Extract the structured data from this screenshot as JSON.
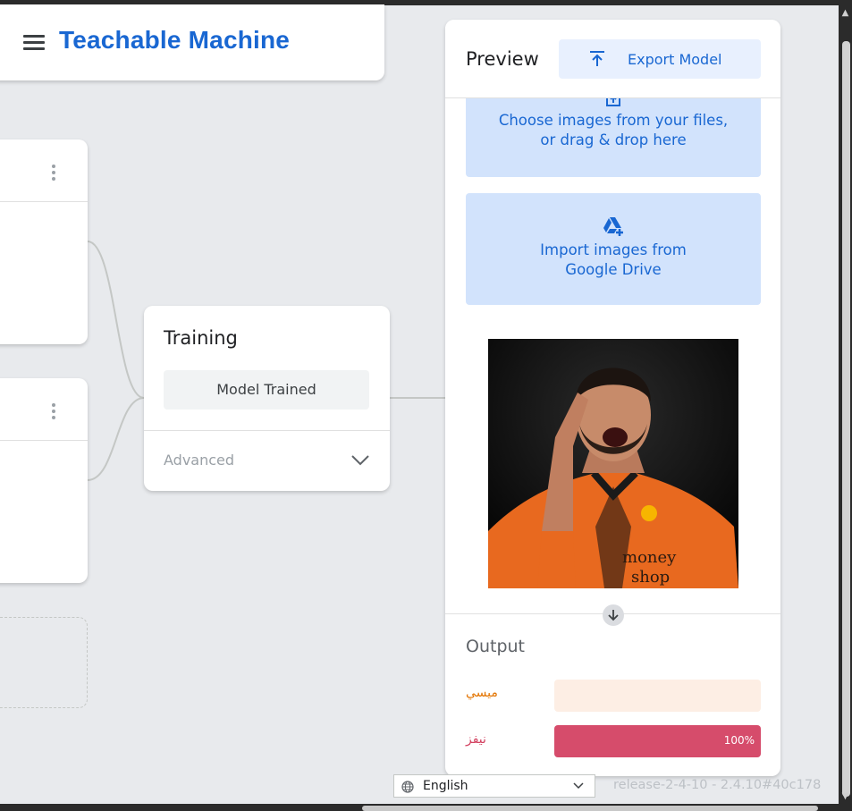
{
  "header": {
    "title": "Teachable Machine"
  },
  "training": {
    "title": "Training",
    "model_button": "Model Trained",
    "advanced_label": "Advanced"
  },
  "preview": {
    "title": "Preview",
    "export_button": "Export Model",
    "upload_files_line1": "Choose images from your files,",
    "upload_files_line2": "or drag & drop here",
    "drive_line1": "Import images from",
    "drive_line2": "Google Drive",
    "output_title": "Output",
    "classes": [
      {
        "label": "ميسي",
        "percent_text": "",
        "value": 0,
        "color": "#e37400",
        "track": "#fdeee4",
        "fill": "#e8710a"
      },
      {
        "label": "نيفز",
        "percent_text": "100%",
        "value": 1,
        "color": "#d23f5e",
        "track": "#fbe2e8",
        "fill": "#d64c6b"
      }
    ]
  },
  "footer": {
    "language": "English",
    "version": "release-2-4-10 - 2.4.10#40c178"
  },
  "colors": {
    "accent": "#1967d2",
    "upload_bg": "#d2e3fc",
    "page_bg": "#e8eaed"
  },
  "icons": [
    "menu-icon",
    "kebab-icon",
    "chevron-down-icon",
    "export-icon",
    "upload-icon",
    "google-drive-icon",
    "arrow-down-icon",
    "globe-icon"
  ]
}
